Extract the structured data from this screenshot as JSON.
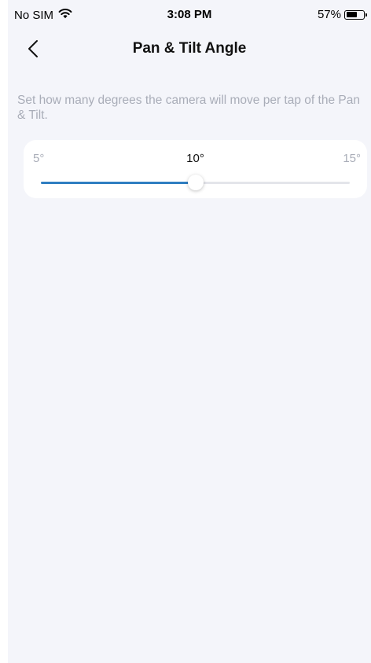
{
  "status_bar": {
    "carrier": "No SIM",
    "time": "3:08 PM",
    "battery": "57%"
  },
  "header": {
    "title": "Pan & Tilt Angle"
  },
  "description": "Set how many degrees the camera will move per tap of the Pan & Tilt.",
  "slider": {
    "min_label": "5°",
    "current_label": "10°",
    "max_label": "15°",
    "min": 5,
    "max": 15,
    "value": 10
  },
  "colors": {
    "accent": "#2f7ec1",
    "background": "#f4f5fa",
    "card": "#ffffff",
    "muted_text": "#a9adb8"
  }
}
